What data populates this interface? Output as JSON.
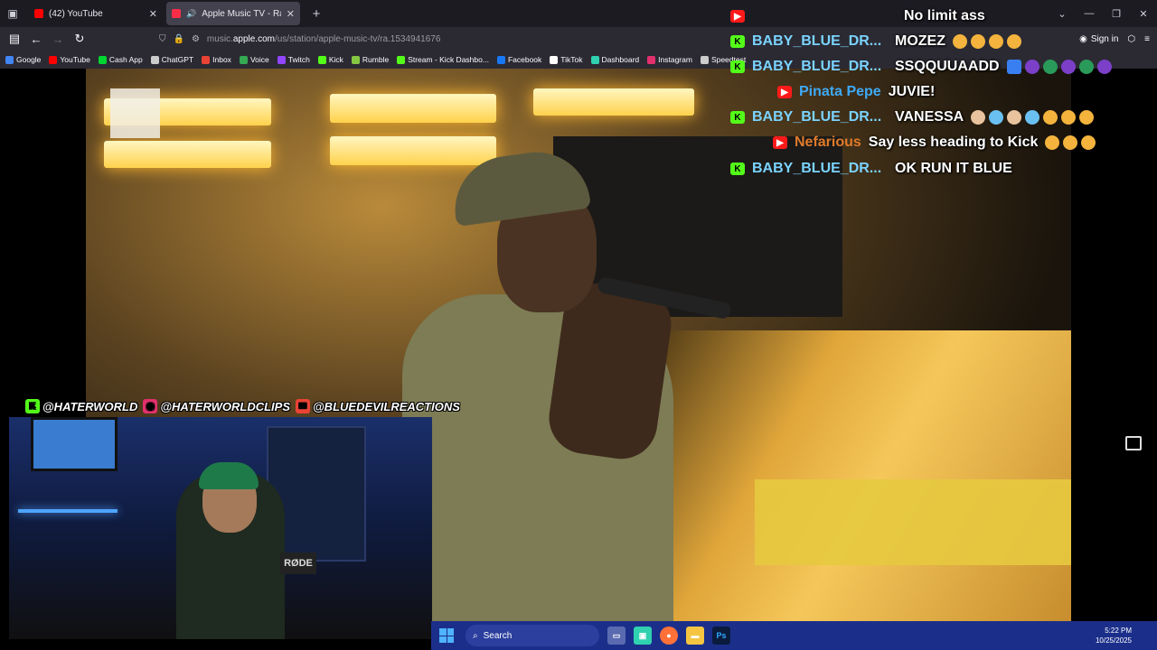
{
  "browser": {
    "tabs": [
      {
        "title": "(42) YouTube",
        "favicon_color": "#ff0000",
        "active": false
      },
      {
        "title": "Apple Music TV - Radio Sta",
        "favicon_color": "#fa2d48",
        "active": true
      }
    ],
    "url_prefix": "music.",
    "url_domain": "apple.com",
    "url_path": "/us/station/apple-music-tv/ra.1534941676",
    "sign_in": "Sign in",
    "bookmarks": [
      {
        "label": "Google",
        "color": "#4285f4"
      },
      {
        "label": "YouTube",
        "color": "#ff0000"
      },
      {
        "label": "Cash App",
        "color": "#00d632"
      },
      {
        "label": "ChatGPT",
        "color": "#cccccc"
      },
      {
        "label": "Inbox",
        "color": "#ea4335"
      },
      {
        "label": "Voice",
        "color": "#34a853"
      },
      {
        "label": "Twitch",
        "color": "#9146ff"
      },
      {
        "label": "Kick",
        "color": "#53fc18"
      },
      {
        "label": "Rumble",
        "color": "#85c742"
      },
      {
        "label": "Stream - Kick Dashbo...",
        "color": "#53fc18"
      },
      {
        "label": "Facebook",
        "color": "#1877f2"
      },
      {
        "label": "TikTok",
        "color": "#ffffff"
      },
      {
        "label": "Dashboard",
        "color": "#2fd1b0"
      },
      {
        "label": "Instagram",
        "color": "#e1306c"
      },
      {
        "label": "Speedtest",
        "color": "#cccccc"
      }
    ]
  },
  "chat": {
    "messages": [
      {
        "platform": "youtube",
        "user": "",
        "text": "No limit ass",
        "emojis": []
      },
      {
        "platform": "kick",
        "user": "BABY_BLUE_DR...",
        "text": "MOZEZ",
        "emojis": [
          "face",
          "face",
          "face",
          "face"
        ]
      },
      {
        "platform": "kick",
        "user": "BABY_BLUE_DR...",
        "text": "SSQQUUAADD",
        "emojis": [
          "arrow",
          "purple",
          "globe",
          "purple",
          "globe",
          "purple"
        ]
      },
      {
        "platform": "youtube",
        "user": "Pinata Pepe",
        "text": "JUVIE!",
        "emojis": []
      },
      {
        "platform": "kick",
        "user": "BABY_BLUE_DR...",
        "text": "VANESSA",
        "emojis": [
          "hand",
          "blue",
          "hand",
          "blue",
          "face",
          "face",
          "face"
        ]
      },
      {
        "platform": "youtube",
        "user": "Nefarious",
        "text": "Say less heading to Kick",
        "emojis": [
          "face",
          "face",
          "face"
        ]
      },
      {
        "platform": "kick",
        "user": "BABY_BLUE_DR...",
        "text": "OK RUN IT BLUE",
        "emojis": []
      }
    ]
  },
  "overlay": {
    "handles": [
      {
        "icon": "kick",
        "label": "@HATERWORLD",
        "color": "#53fc18"
      },
      {
        "icon": "instagram",
        "label": "@HATERWORLDCLIPS",
        "color": "#e1306c"
      },
      {
        "icon": "mail",
        "label": "@BLUEDEVILREACTIONS",
        "color": "#ea4335"
      }
    ],
    "mic_label": "RØDE"
  },
  "taskbar": {
    "search_label": "Search",
    "time": "5:22 PM",
    "date": "10/25/2025"
  }
}
